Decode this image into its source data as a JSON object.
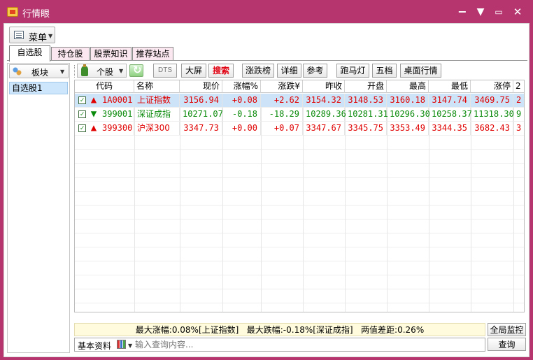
{
  "window": {
    "title": "行情眼"
  },
  "menu": {
    "label": "菜单"
  },
  "tabs": [
    "自选股",
    "持仓股",
    "股票知识",
    "推荐站点"
  ],
  "sector": {
    "label": "板块"
  },
  "watchlist": {
    "items": [
      "自选股1"
    ]
  },
  "toolbar": {
    "stock_type": "个股",
    "buttons": [
      "DTS",
      "大屏",
      "搜索",
      "涨跌榜",
      "详细",
      "参考",
      "跑马灯",
      "五档",
      "桌面行情"
    ]
  },
  "table": {
    "headers": [
      "代码",
      "名称",
      "现价",
      "涨幅%",
      "涨跌¥",
      "昨收",
      "开盘",
      "最高",
      "最低",
      "涨停",
      "2"
    ],
    "rows": [
      {
        "code": "1A0001",
        "name": "上证指数",
        "price": "3156.94",
        "change_pct": "+0.08",
        "change_amt": "+2.62",
        "prev_close": "3154.32",
        "open": "3148.53",
        "high": "3160.18",
        "low": "3147.74",
        "limit_up": "3469.75",
        "extra": "2",
        "trend": "up",
        "color": "#e00000"
      },
      {
        "code": "399001",
        "name": "深证成指",
        "price": "10271.07",
        "change_pct": "-0.18",
        "change_amt": "-18.29",
        "prev_close": "10289.36",
        "open": "10281.31",
        "high": "10296.30",
        "low": "10258.37",
        "limit_up": "11318.30",
        "extra": "9",
        "trend": "down",
        "color": "#0a8a0a"
      },
      {
        "code": "399300",
        "name": "沪深300",
        "price": "3347.73",
        "change_pct": "+0.00",
        "change_amt": "+0.07",
        "prev_close": "3347.67",
        "open": "3345.75",
        "high": "3353.49",
        "low": "3344.35",
        "limit_up": "3682.43",
        "extra": "3",
        "trend": "up",
        "color": "#e00000"
      }
    ]
  },
  "summary": {
    "text": "最大涨幅:0.08%[上证指数]   最大跌幅:-0.18%[深证成指]   两值差距:0.26%"
  },
  "right_buttons": {
    "monitor": "全局监控",
    "query": "查询"
  },
  "bottom": {
    "basic_info": "基本资料",
    "placeholder": "输入查询内容..."
  },
  "icons": [
    "app-icon",
    "menu-icon",
    "sector-icon",
    "bottle-icon",
    "refresh-icon",
    "checkbox-icon",
    "up-arrow-icon",
    "down-arrow-icon",
    "chart-icon"
  ],
  "colors": {
    "title_bar": "#b6356f",
    "up": "#e00000",
    "down": "#0a8a0a",
    "selected_row": "#cce3f8"
  }
}
